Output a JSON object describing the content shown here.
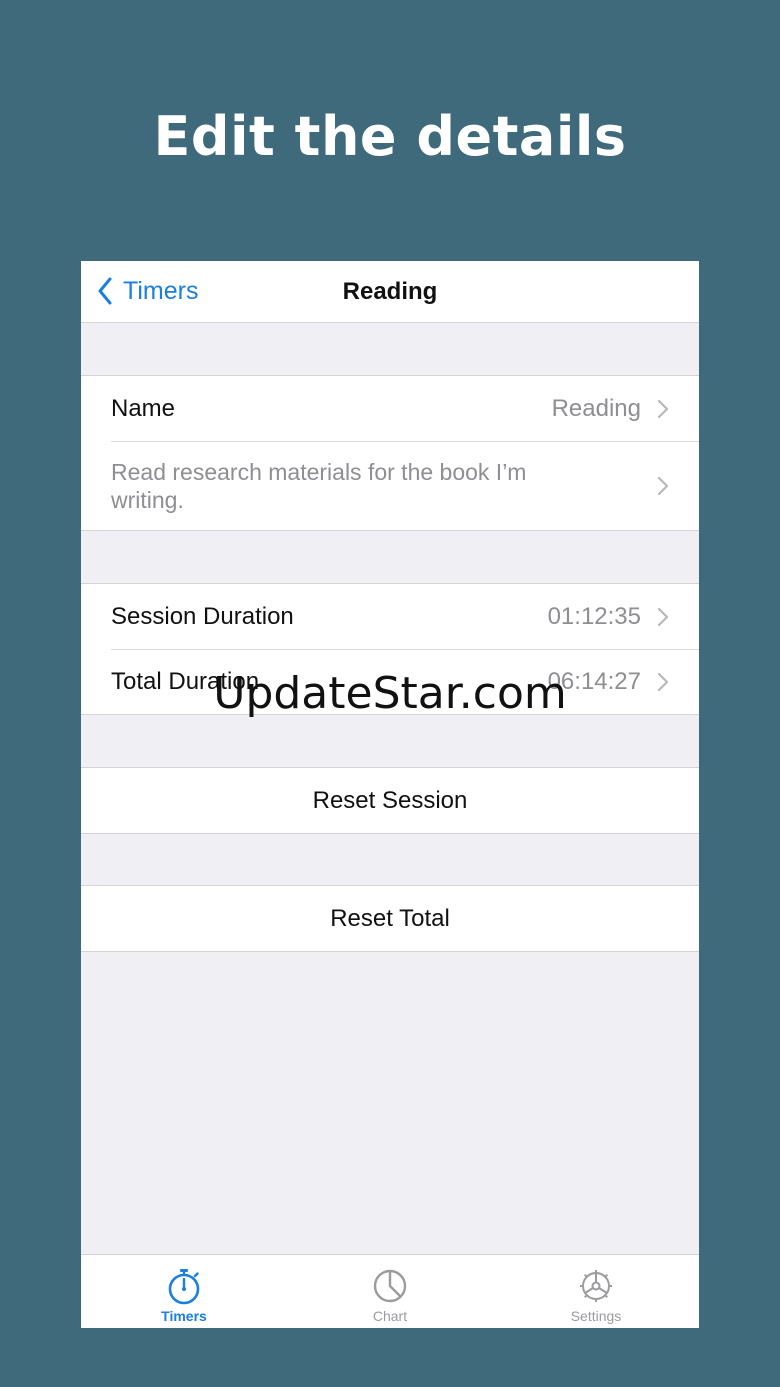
{
  "headline": "Edit the details",
  "navbar": {
    "back_label": "Timers",
    "title": "Reading"
  },
  "details": {
    "name_label": "Name",
    "name_value": "Reading",
    "description": "Read research materials for the book I’m writing."
  },
  "durations": {
    "session_label": "Session Duration",
    "session_value": "01:12:35",
    "total_label": "Total Duration",
    "total_value": "06:14:27"
  },
  "actions": {
    "reset_session": "Reset Session",
    "reset_total": "Reset Total"
  },
  "tabbar": {
    "items": [
      {
        "label": "Timers",
        "icon": "stopwatch-icon",
        "active": true
      },
      {
        "label": "Chart",
        "icon": "pie-chart-icon",
        "active": false
      },
      {
        "label": "Settings",
        "icon": "gear-icon",
        "active": false
      }
    ]
  },
  "watermark": "UpdateStar.com",
  "colors": {
    "background": "#3e6a7b",
    "accent": "#1a7fe0",
    "secondary_text": "#8e8e93",
    "inactive_tab": "#9b9ba0"
  }
}
